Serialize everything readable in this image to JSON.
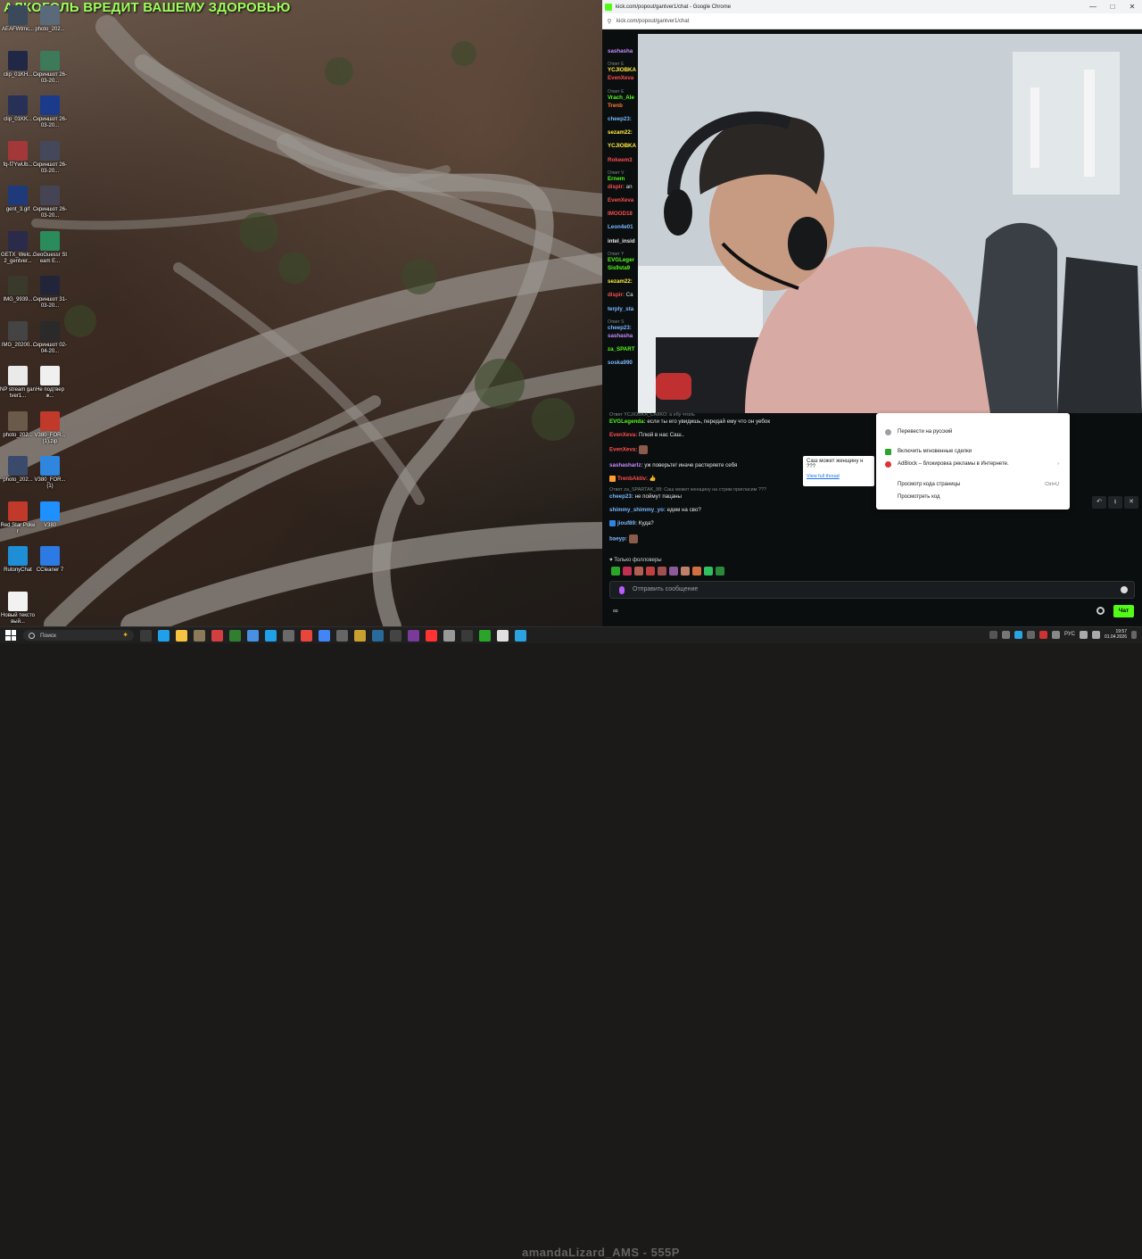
{
  "desktop": {
    "banner": "АЛКОГОЛЬ ВРЕДИТ ВАШЕМУ ЗДОРОВЬЮ",
    "icons": [
      {
        "label": "AEAFWtmc...",
        "color": "#3a4a5a",
        "icon": "image-icon"
      },
      {
        "label": "photo_202...",
        "color": "#5a6a7a",
        "icon": "image-icon"
      },
      {
        "label": "clip_01KH...",
        "color": "#202845",
        "icon": "video-icon"
      },
      {
        "label": "Скриншот 26-03-20...",
        "color": "#3c7a5a",
        "icon": "image-icon"
      },
      {
        "label": "clip_01KK...",
        "color": "#273056",
        "icon": "video-icon"
      },
      {
        "label": "Скриншот 26-03-20...",
        "color": "#1b3a8a",
        "icon": "image-icon"
      },
      {
        "label": "fq-f7YwUb...",
        "color": "#a33838",
        "icon": "image-icon"
      },
      {
        "label": "Скриншот 26-03-20...",
        "color": "#44485a",
        "icon": "image-icon"
      },
      {
        "label": "gent_3.gif",
        "color": "#1e3a7a",
        "icon": "gif-icon"
      },
      {
        "label": "Скриншот 26-03-20...",
        "color": "#445",
        "icon": "image-icon"
      },
      {
        "label": "GETX_Welc... 2_gentver...",
        "color": "#2a2a4a",
        "icon": "image-icon"
      },
      {
        "label": "GeoGuessr Steam E...",
        "color": "#2a8c5a",
        "icon": "geoguessr-icon"
      },
      {
        "label": "IMG_9939...",
        "color": "#3a3a2a",
        "icon": "image-icon"
      },
      {
        "label": "Скриншот 31-03-20...",
        "color": "#22253a",
        "icon": "image-icon"
      },
      {
        "label": "IMG_20200...",
        "color": "#444",
        "icon": "image-icon"
      },
      {
        "label": "Скриншот 02-04-20...",
        "color": "#2a2a2a",
        "icon": "image-icon"
      },
      {
        "label": "NP stream gantver1...",
        "color": "#eaeaea",
        "icon": "document-icon"
      },
      {
        "label": "Не подтверж...",
        "color": "#f0f0f0",
        "icon": "document-icon"
      },
      {
        "label": "photo_202...",
        "color": "#6a5a4a",
        "icon": "image-icon"
      },
      {
        "label": "V380_FOR... (1).zip",
        "color": "#c0392b",
        "icon": "archive-icon"
      },
      {
        "label": "photo_202...",
        "color": "#3a4a6a",
        "icon": "image-icon"
      },
      {
        "label": "V380_FOR... (1)",
        "color": "#2e86de",
        "icon": "app-icon"
      },
      {
        "label": "Red Star Poker",
        "color": "#c0392b",
        "icon": "poker-icon"
      },
      {
        "label": "V380",
        "color": "#1e90ff",
        "icon": "camera-app-icon"
      },
      {
        "label": "RutonyChat",
        "color": "#1e8fd6",
        "icon": "chat-app-icon"
      },
      {
        "label": "CCleaner 7",
        "color": "#2c7be5",
        "icon": "ccleaner-icon"
      },
      {
        "label": "Новый текстовый...",
        "color": "#f2f2f2",
        "icon": "text-file-icon"
      }
    ]
  },
  "browser": {
    "title": "kick.com/popout/gantver1/chat - Google Chrome",
    "url": "kick.com/popout/gantver1/chat",
    "window_buttons": [
      "—",
      "□",
      "✕"
    ]
  },
  "chat": {
    "top_messages": [
      {
        "reply": "",
        "user": "sashasha",
        "color": "#c58cff",
        "msg": ""
      },
      {
        "reply": "Ответ Е",
        "user": "YCJIOBKA",
        "color": "#ffef3d",
        "msg": ""
      },
      {
        "reply": "",
        "user": "EvenXeva",
        "color": "#ff4d4d",
        "msg": ""
      },
      {
        "reply": "Ответ Е",
        "user": "Vrach_Ale",
        "color": "#53fc18",
        "msg": ""
      },
      {
        "reply": "",
        "user": "Trenb",
        "color": "#ff7a2f",
        "msg": ""
      },
      {
        "reply": "",
        "user": "cheep23:",
        "color": "#7ab8ff",
        "msg": ""
      },
      {
        "reply": "",
        "user": "sezam22:",
        "color": "#ffef3d",
        "msg": ""
      },
      {
        "reply": "",
        "user": "YCJIOBKA",
        "color": "#ffef3d",
        "msg": ""
      },
      {
        "reply": "",
        "user": "Rokeem3",
        "color": "#ff4d4d",
        "msg": ""
      },
      {
        "reply": "Ответ V",
        "user": "Ernem",
        "color": "#53fc18",
        "msg": ""
      },
      {
        "reply": "",
        "user": "dispir:",
        "color": "#ff4d4d",
        "msg": "an"
      },
      {
        "reply": "",
        "user": "EvenXeva",
        "color": "#ff4d4d",
        "msg": ""
      },
      {
        "reply": "",
        "user": "IMOOD18",
        "color": "#ff4d4d",
        "msg": ""
      },
      {
        "reply": "",
        "user": "Leon4e01",
        "color": "#7ab8ff",
        "msg": ""
      },
      {
        "reply": "",
        "user": "intel_insid",
        "color": "#e8e8e8",
        "msg": ""
      },
      {
        "reply": "Ответ Y",
        "user": "EVGLeger",
        "color": "#53fc18",
        "msg": ""
      },
      {
        "reply": "",
        "user": "Sis9sta9",
        "color": "#53fc18",
        "msg": ""
      },
      {
        "reply": "",
        "user": "sezam22:",
        "color": "#ffef3d",
        "msg": ""
      },
      {
        "reply": "",
        "user": "dispir:",
        "color": "#ff4d4d",
        "msg": "Ca"
      },
      {
        "reply": "",
        "user": "terply_sta",
        "color": "#7ab8ff",
        "msg": ""
      },
      {
        "reply": "Ответ S",
        "user": "cheep23:",
        "color": "#7ab8ff",
        "msg": ""
      },
      {
        "reply": "",
        "user": "sashasha",
        "color": "#c58cff",
        "msg": ""
      },
      {
        "reply": "",
        "user": "za_SPART",
        "color": "#53fc18",
        "msg": ""
      },
      {
        "reply": "",
        "user": "soska990",
        "color": "#7ab8ff",
        "msg": ""
      }
    ],
    "bottom_messages": [
      {
        "reply": "Ответ YCJIOBKA_CAIIKO: а ебу чтоль",
        "user": "EVGLegenda:",
        "color": "#53fc18",
        "msg": "если ты его увидишь, передай ему что он уебок",
        "badge": ""
      },
      {
        "reply": "",
        "user": "EvenXeva:",
        "color": "#ff4d4d",
        "msg": "Плюй в нас Саш..",
        "badge": ""
      },
      {
        "reply": "",
        "user": "EvenXeva:",
        "color": "#ff4d4d",
        "msg": "",
        "badge": "",
        "emote": true
      },
      {
        "reply": "",
        "user": "sashasharlz:",
        "color": "#c58cff",
        "msg": "уж поверьте! иначе растеряете себя",
        "badge": ""
      },
      {
        "reply": "",
        "user": "TrenbAktiv:",
        "color": "#ff4d4d",
        "msg": "👍",
        "badge": "#ff9d2f"
      },
      {
        "reply": "Ответ za_SPARTAK_88: Саш может женщину на стрим пригласим ???",
        "user": "cheep23:",
        "color": "#7ab8ff",
        "msg": "не поймут пацаны",
        "badge": ""
      },
      {
        "reply": "",
        "user": "shimmy_shimmy_yo:",
        "color": "#7ab8ff",
        "msg": "едем на сво?",
        "badge": ""
      },
      {
        "reply": "",
        "user": "jiouf89:",
        "color": "#7ab8ff",
        "msg": "Куда?",
        "badge": "#2e86de"
      },
      {
        "reply": "",
        "user": "baeyp:",
        "color": "#7ab8ff",
        "msg": "",
        "badge": "",
        "emote": true
      }
    ],
    "pinned_popup": {
      "text": "Саш может женщину н ???",
      "link": "View full thread"
    },
    "followers_label": "Только фолловеры",
    "input_placeholder": "Отправить сообщение",
    "send_label": "Чат",
    "infinity_label": "∞"
  },
  "context_menu": {
    "items": [
      {
        "label": "Перевести на русский",
        "icon": "translate-icon",
        "shortcut": ""
      },
      {
        "label": "Включить мгновенные сделки",
        "icon": "extension-icon",
        "shortcut": ""
      },
      {
        "label": "AdBlock – блокировка рекламы в Интернете.",
        "icon": "adblock-icon",
        "shortcut": "›"
      },
      {
        "label": "Просмотр кода страницы",
        "icon": "",
        "shortcut": "Ctrl+U"
      },
      {
        "label": "Просмотреть код",
        "icon": "",
        "shortcut": ""
      }
    ]
  },
  "taskbar": {
    "search_placeholder": "Поиск",
    "time": "19:57",
    "date": "01.04.2026",
    "lang": "РУС",
    "overlay_text": "amandaLizard_AMS - 555P",
    "apps": [
      {
        "name": "task-view-icon",
        "color": "#3a3a3a"
      },
      {
        "name": "edge-icon",
        "color": "#1fa0e8"
      },
      {
        "name": "explorer-icon",
        "color": "#f5c242"
      },
      {
        "name": "app-icon",
        "color": "#8a7a5a"
      },
      {
        "name": "app-64-icon",
        "color": "#d13f3f"
      },
      {
        "name": "app-icon",
        "color": "#2f7f2f"
      },
      {
        "name": "app-icon",
        "color": "#4a90e2"
      },
      {
        "name": "edge-icon",
        "color": "#1fa0e8"
      },
      {
        "name": "app-icon",
        "color": "#6a6a6a"
      },
      {
        "name": "chrome-icon",
        "color": "#e8453c"
      },
      {
        "name": "app-icon",
        "color": "#4285f4"
      },
      {
        "name": "app-icon",
        "color": "#666"
      },
      {
        "name": "app-icon",
        "color": "#c8a030"
      },
      {
        "name": "app-icon",
        "color": "#2a6a9a"
      },
      {
        "name": "app-icon",
        "color": "#444"
      },
      {
        "name": "app-icon",
        "color": "#7a3a9a"
      },
      {
        "name": "yandex-icon",
        "color": "#ff3333"
      },
      {
        "name": "app-icon",
        "color": "#999"
      },
      {
        "name": "app-icon",
        "color": "#3a3a3a"
      },
      {
        "name": "app-icon",
        "color": "#2aa52a"
      },
      {
        "name": "app-icon",
        "color": "#e0e0e0"
      },
      {
        "name": "telegram-icon",
        "color": "#2aa3e0"
      }
    ]
  }
}
